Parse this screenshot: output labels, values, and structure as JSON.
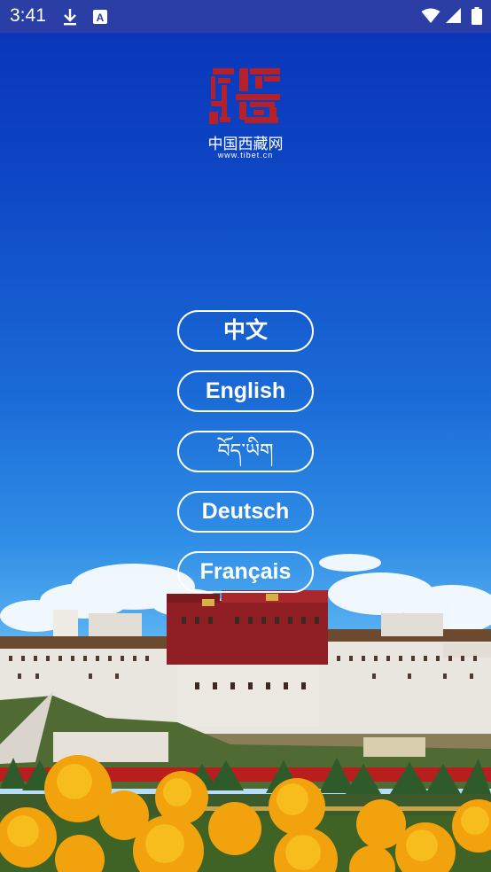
{
  "status_bar": {
    "time": "3:41",
    "left_icons": [
      "download-icon",
      "keyboard-a-icon"
    ],
    "right_icons": [
      "wifi-icon",
      "cellular-signal-icon",
      "battery-icon"
    ]
  },
  "logo": {
    "chinese": "中国西藏网",
    "url": "www.tibet.cn",
    "colors": {
      "mark": "#b5212a",
      "text": "#ffffff"
    }
  },
  "languages": [
    {
      "label": "中文"
    },
    {
      "label": "English"
    },
    {
      "label": "བོད་ཡིག"
    },
    {
      "label": "Deutsch"
    },
    {
      "label": "Français"
    }
  ],
  "colors": {
    "sky_top": "#0933b6",
    "sky_bottom": "#b9dcf7",
    "status_bar": "#2a3ea6",
    "palace_red": "#8f1f24",
    "flower": "#f2a20c"
  }
}
